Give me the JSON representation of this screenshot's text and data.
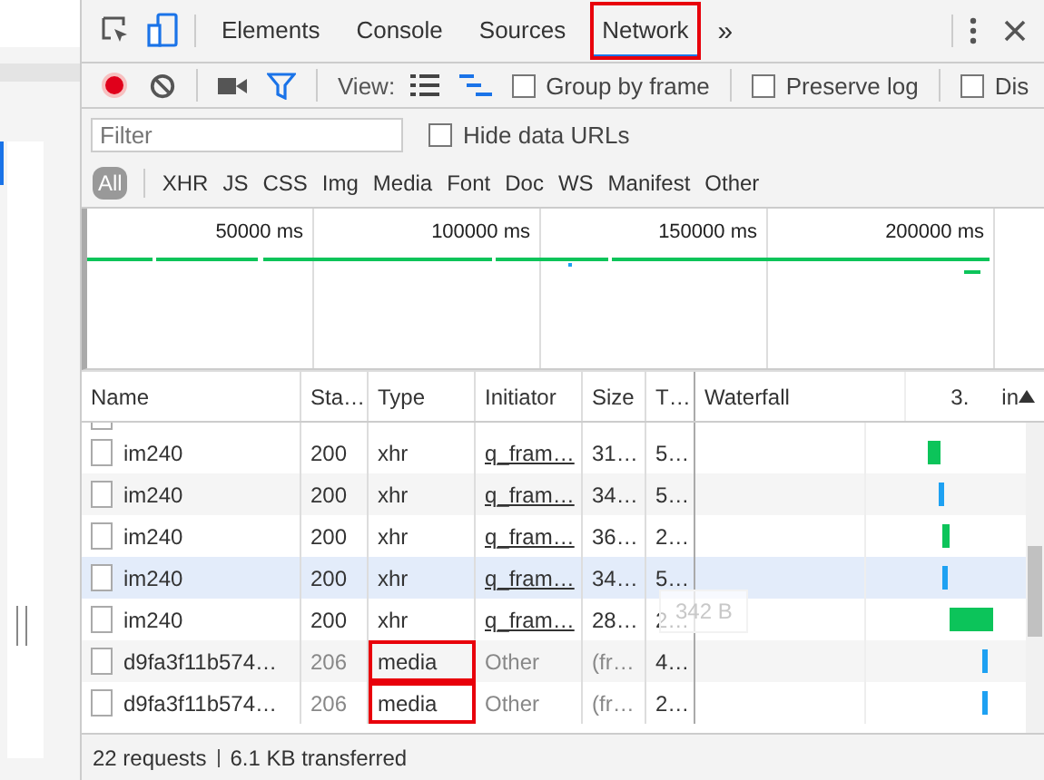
{
  "tabs": [
    {
      "label": "Elements",
      "selected": false,
      "highlighted": false
    },
    {
      "label": "Console",
      "selected": false,
      "highlighted": false
    },
    {
      "label": "Sources",
      "selected": false,
      "highlighted": false
    },
    {
      "label": "Network",
      "selected": true,
      "highlighted": true
    }
  ],
  "more_tabs": "»",
  "toolbar": {
    "recording": true,
    "view_label": "View:",
    "options": [
      {
        "label": "Group by frame",
        "checked": false
      },
      {
        "label": "Preserve log",
        "checked": false
      },
      {
        "label": "Dis",
        "checked": false
      }
    ]
  },
  "filter": {
    "placeholder": "Filter",
    "hide_data_urls": {
      "label": "Hide data URLs",
      "checked": false
    }
  },
  "type_filters": [
    {
      "label": "All",
      "selected": true
    },
    {
      "label": "XHR",
      "selected": false
    },
    {
      "label": "JS",
      "selected": false
    },
    {
      "label": "CSS",
      "selected": false
    },
    {
      "label": "Img",
      "selected": false
    },
    {
      "label": "Media",
      "selected": false
    },
    {
      "label": "Font",
      "selected": false
    },
    {
      "label": "Doc",
      "selected": false
    },
    {
      "label": "WS",
      "selected": false
    },
    {
      "label": "Manifest",
      "selected": false
    },
    {
      "label": "Other",
      "selected": false
    }
  ],
  "overview": {
    "ticks": [
      "50000 ms",
      "100000 ms",
      "150000 ms",
      "200000 ms"
    ]
  },
  "table": {
    "columns": [
      "Name",
      "Sta…",
      "Type",
      "Initiator",
      "Size",
      "T…",
      "Waterfall",
      "3.",
      "in"
    ],
    "rows": [
      {
        "name": "im240",
        "status": "200",
        "type": "xhr",
        "initiator": "q_fram…",
        "size": "31…",
        "time": "5…",
        "kind": "script",
        "selected": false,
        "highlighted": false,
        "color": "#0cc45a"
      },
      {
        "name": "im240",
        "status": "200",
        "type": "xhr",
        "initiator": "q_fram…",
        "size": "34…",
        "time": "5…",
        "kind": "script",
        "selected": false,
        "highlighted": false,
        "color": "#1ea1f2"
      },
      {
        "name": "im240",
        "status": "200",
        "type": "xhr",
        "initiator": "q_fram…",
        "size": "36…",
        "time": "2…",
        "kind": "script",
        "selected": false,
        "highlighted": false,
        "color": "#0cc45a"
      },
      {
        "name": "im240",
        "status": "200",
        "type": "xhr",
        "initiator": "q_fram…",
        "size": "34…",
        "time": "5…",
        "kind": "script",
        "selected": true,
        "highlighted": false,
        "color": "#1ea1f2"
      },
      {
        "name": "im240",
        "status": "200",
        "type": "xhr",
        "initiator": "q_fram…",
        "size": "28…",
        "time": "2…",
        "kind": "script",
        "selected": false,
        "highlighted": false,
        "color": "#0cc45a"
      },
      {
        "name": "d9fa3f11b574…",
        "status": "206",
        "type": "media",
        "initiator": "Other",
        "size": "(fr…",
        "time": "4…",
        "kind": "other",
        "selected": false,
        "highlighted": true,
        "color": "#1ea1f2"
      },
      {
        "name": "d9fa3f11b574…",
        "status": "206",
        "type": "media",
        "initiator": "Other",
        "size": "(fr…",
        "time": "2…",
        "kind": "other",
        "selected": false,
        "highlighted": true,
        "color": "#1ea1f2"
      }
    ]
  },
  "tooltip": "342 B",
  "status_bar": {
    "requests": "22 requests",
    "transferred": "6.1 KB transferred"
  }
}
